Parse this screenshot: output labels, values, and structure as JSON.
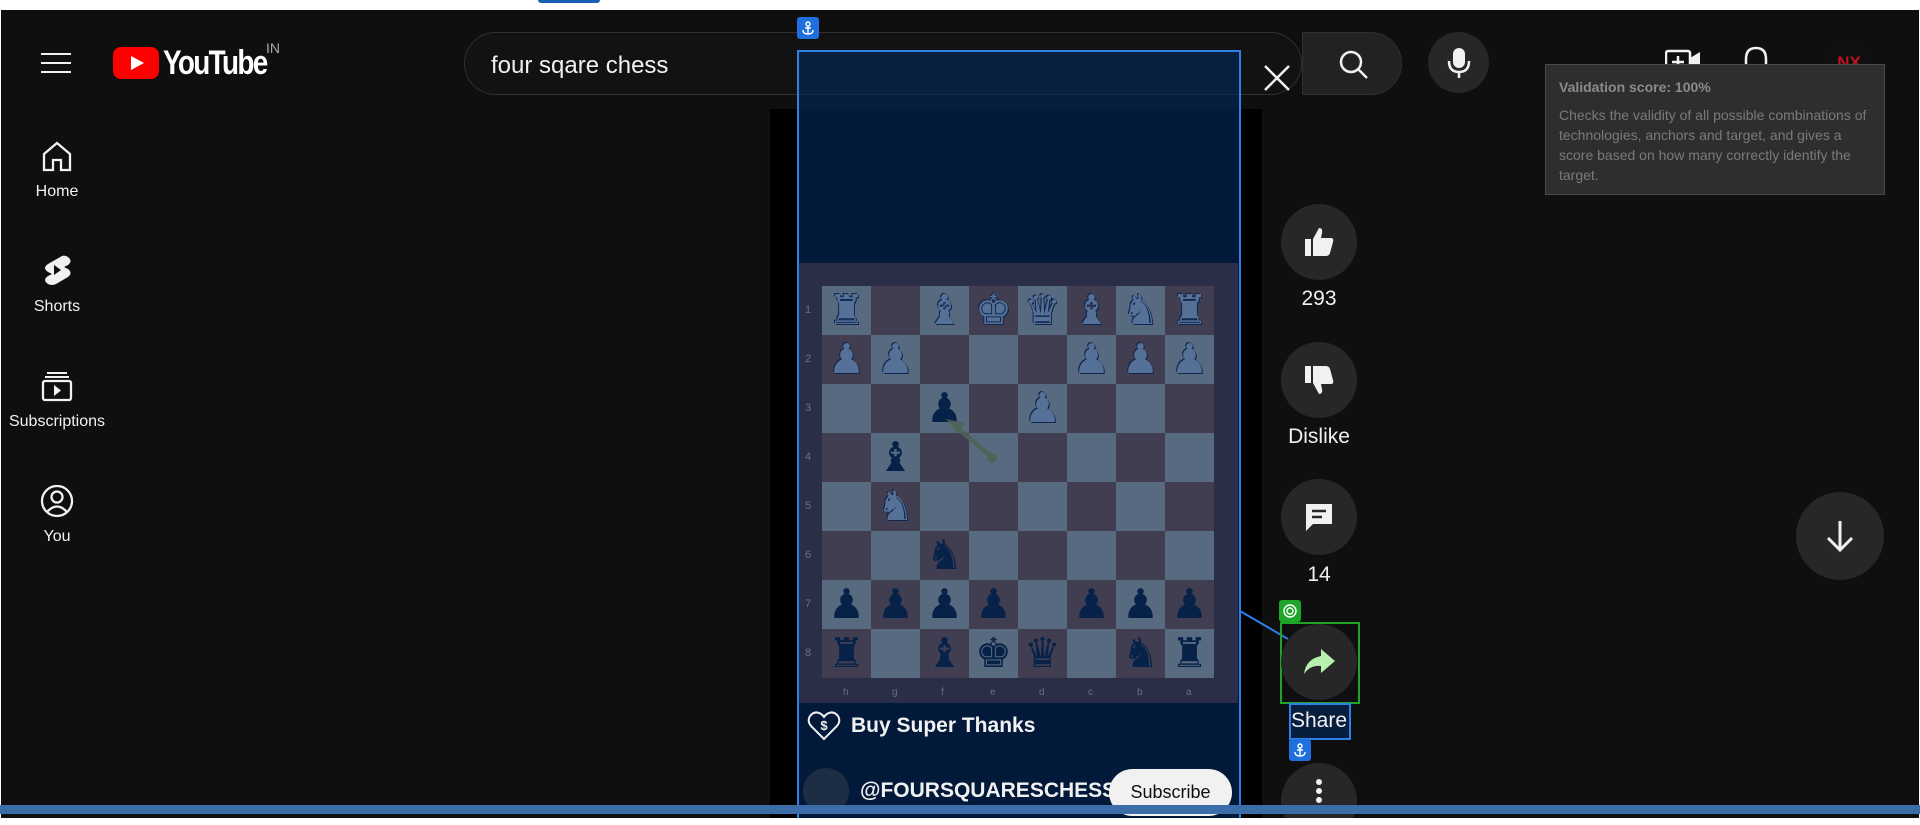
{
  "header": {
    "logo_text": "YouTube",
    "region": "IN",
    "search_value": "four sqare chess",
    "avatar_text": "NX"
  },
  "sidebar": {
    "items": [
      {
        "label": "Home",
        "icon": "home-icon"
      },
      {
        "label": "Shorts",
        "icon": "shorts-icon"
      },
      {
        "label": "Subscriptions",
        "icon": "subscriptions-icon"
      },
      {
        "label": "You",
        "icon": "you-icon"
      }
    ]
  },
  "video": {
    "board": {
      "ranks": [
        "1",
        "2",
        "3",
        "4",
        "5",
        "6",
        "7",
        "8"
      ],
      "files": [
        "h",
        "g",
        "f",
        "e",
        "d",
        "c",
        "b",
        "a"
      ],
      "rows": [
        [
          "wR",
          "",
          "wB",
          "wK",
          "wQ",
          "wB",
          "wN",
          "wR"
        ],
        [
          "wP",
          "wP",
          "",
          "",
          "",
          "wP",
          "wP",
          "wP"
        ],
        [
          "",
          "",
          "bP",
          "",
          "wP",
          "",
          "",
          ""
        ],
        [
          "",
          "bB",
          "",
          "",
          "",
          "",
          "",
          ""
        ],
        [
          "",
          "wN",
          "",
          "",
          "",
          "",
          "",
          ""
        ],
        [
          "",
          "",
          "bN",
          "",
          "",
          "",
          "",
          ""
        ],
        [
          "bP",
          "bP",
          "bP",
          "bP",
          "",
          "bP",
          "bP",
          "bP"
        ],
        [
          "bR",
          "",
          "bB",
          "bK",
          "bQ",
          "",
          "bN",
          "bR"
        ]
      ]
    },
    "super_thanks": "Buy Super Thanks",
    "channel": "@FOURSQUARESCHESS",
    "subscribe": "Subscribe"
  },
  "actions": {
    "likes": "293",
    "dislike": "Dislike",
    "comments": "14",
    "share": "Share"
  },
  "tooltip": {
    "title": "Validation score: 100%",
    "body": "Checks the validity of all possible combinations of technologies, anchors and target, and gives a score based on how many correctly identify the target."
  },
  "colors": {
    "background": "#0f0f0f",
    "logo_red": "#ff0000",
    "anchor_blue": "#2f7fe6",
    "target_green": "#1fa62a"
  }
}
